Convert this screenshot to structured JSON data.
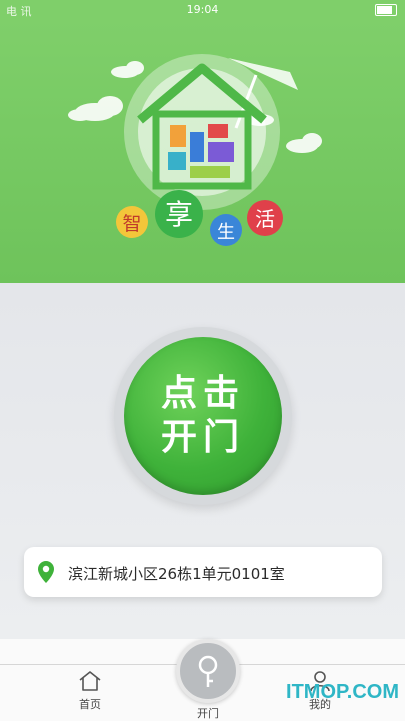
{
  "status_bar": {
    "left_text": "电 讯",
    "time": "19:04"
  },
  "hero": {
    "logo_chars": [
      "智",
      "享",
      "生",
      "活"
    ],
    "colors": {
      "background": "#76c963",
      "logo_green": "#4fb848"
    }
  },
  "main": {
    "open_button": {
      "line1": "点击",
      "line2": "开门"
    },
    "address": {
      "text": "滨江新城小区26栋1单元0101室"
    }
  },
  "tabbar": {
    "home_label": "首页",
    "open_label": "开门",
    "mine_label": "我的"
  },
  "watermark": "ITMOP.COM"
}
